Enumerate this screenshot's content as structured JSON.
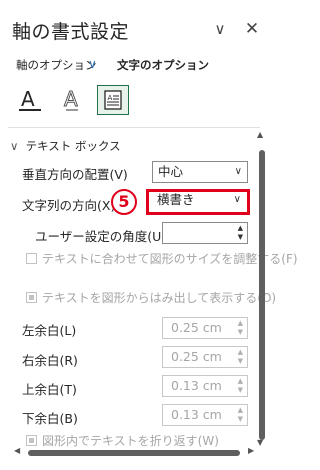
{
  "title": "軸の書式設定",
  "title_icons": {
    "collapse": "chevron-down-icon",
    "close": "close-icon"
  },
  "tabs": {
    "axis_options": "軸のオプション",
    "text_options": "文字のオプション"
  },
  "icon_buttons": [
    {
      "name": "text-fill-outline-icon",
      "label": "A"
    },
    {
      "name": "text-effects-icon",
      "label": "A"
    },
    {
      "name": "textbox-icon",
      "selected": true
    }
  ],
  "section": {
    "title": "テキスト ボックス",
    "vertical_alignment": {
      "label": "垂直方向の配置(V)",
      "value": "中心"
    },
    "text_direction": {
      "label": "文字列の方向(X)",
      "value": "横書き",
      "highlighted": true
    },
    "custom_angle": {
      "label": "ユーザー設定の角度(U)",
      "value": ""
    },
    "autofit": {
      "label": "テキストに合わせて図形のサイズを調整する(F)",
      "checked": false,
      "enabled": false
    },
    "overflow": {
      "label": "テキストを図形からはみ出して表示する(O)",
      "checked": true,
      "enabled": false
    },
    "left_margin": {
      "label": "左余白(L)",
      "value": "0.25 cm"
    },
    "right_margin": {
      "label": "右余白(R)",
      "value": "0.25 cm"
    },
    "top_margin": {
      "label": "上余白(T)",
      "value": "0.13 cm"
    },
    "bottom_margin": {
      "label": "下余白(B)",
      "value": "0.13 cm"
    },
    "wrap": {
      "label": "図形内でテキストを折り返す(W)",
      "checked": true,
      "enabled": false
    }
  },
  "step_badge": "5",
  "colors": {
    "accent": "#217346",
    "highlight": "#e0001b",
    "link_blue": "#2f6fb5"
  }
}
